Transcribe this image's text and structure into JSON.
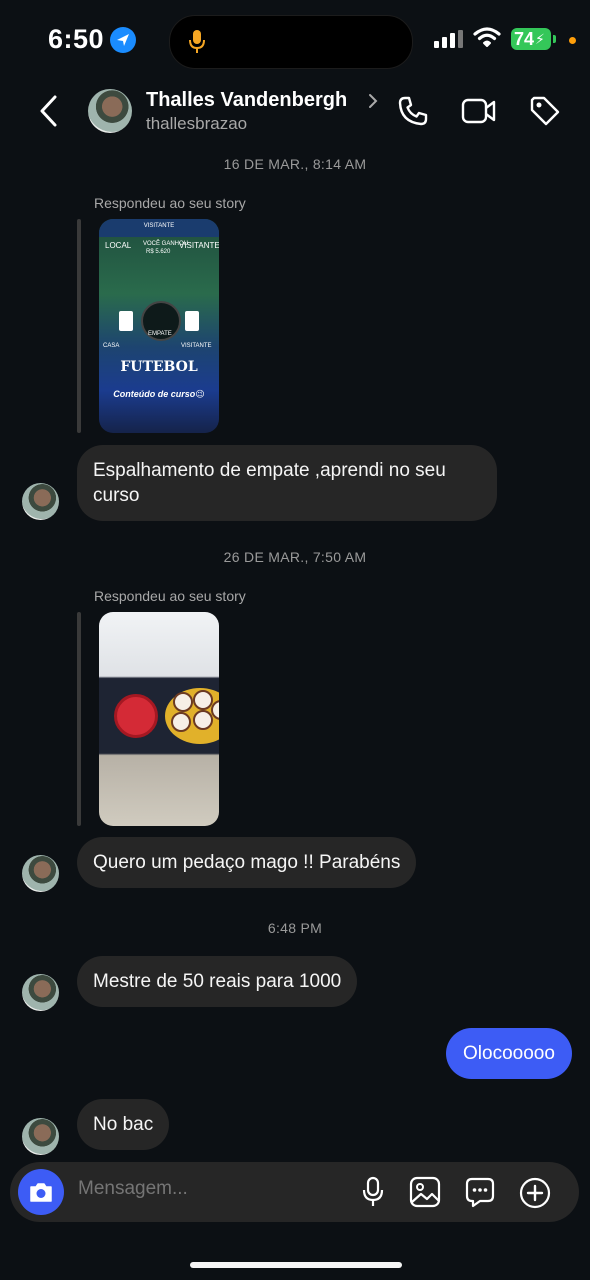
{
  "status_bar": {
    "time": "6:50",
    "battery": "74"
  },
  "header": {
    "contact_name": "Thalles Vandenbergh",
    "contact_handle": "thallesbrazao",
    "icons": [
      "back-icon",
      "phone-icon",
      "video-icon",
      "tag-icon"
    ]
  },
  "conversation": {
    "timestamp_1": "16 DE MAR., 8:14 AM",
    "reply_label_1": "Respondeu ao seu story",
    "story_1": {
      "top_text": "VISITANTE",
      "local": "LOCAL",
      "visitante_top": "VISITANTE",
      "won": "VOCÊ GANHOU",
      "amount": "R$ 5.620",
      "center": "EMPATE",
      "left_label": "CASA",
      "right_label": "VISITANTE",
      "logo": "FUTEBOL",
      "caption": "Conteúdo de curso😉"
    },
    "message_1": "Espalhamento de empate ,aprendi no seu curso",
    "timestamp_2": "26 DE MAR., 7:50 AM",
    "reply_label_2": "Respondeu ao seu story",
    "message_2": "Quero um pedaço mago !! Parabéns",
    "timestamp_3": "6:48 PM",
    "message_3": "Mestre de 50 reais para 1000",
    "message_out": "Olocooooo",
    "message_4": "No bac"
  },
  "composer": {
    "placeholder": "Mensagem...",
    "icons": [
      "camera-icon",
      "microphone-icon",
      "gallery-icon",
      "sticker-icon",
      "plus-icon"
    ]
  },
  "colors": {
    "background": "#0c1014",
    "bubble_in": "#262626",
    "bubble_out": "#3d5cf5",
    "battery": "#34c759"
  }
}
